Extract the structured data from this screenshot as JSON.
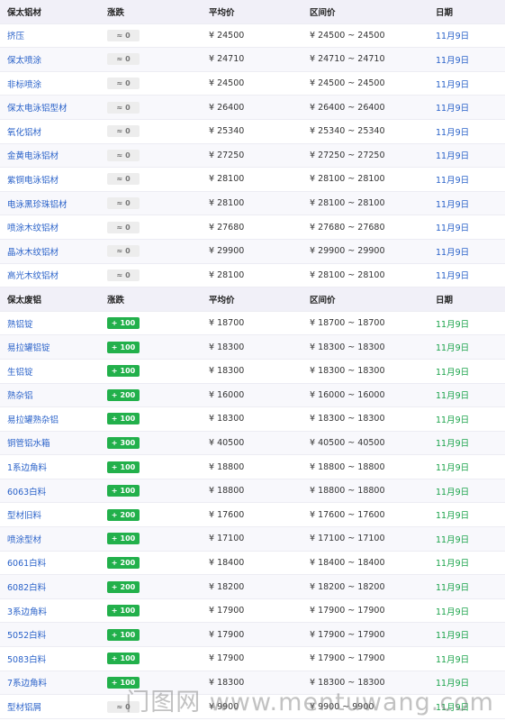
{
  "sections": [
    {
      "header": {
        "name": "保太铝材",
        "change": "涨跌",
        "avg": "平均价",
        "range": "区间价",
        "date": "日期"
      },
      "date_style": "blue",
      "rows": [
        {
          "name": "挤压",
          "change": "0",
          "dir": "flat",
          "avg": "¥ 24500",
          "range": "¥ 24500 ~ 24500",
          "date": "11月9日"
        },
        {
          "name": "保太喷涂",
          "change": "0",
          "dir": "flat",
          "avg": "¥ 24710",
          "range": "¥ 24710 ~ 24710",
          "date": "11月9日"
        },
        {
          "name": "非标喷涂",
          "change": "0",
          "dir": "flat",
          "avg": "¥ 24500",
          "range": "¥ 24500 ~ 24500",
          "date": "11月9日"
        },
        {
          "name": "保太电泳铝型材",
          "change": "0",
          "dir": "flat",
          "avg": "¥ 26400",
          "range": "¥ 26400 ~ 26400",
          "date": "11月9日"
        },
        {
          "name": "氧化铝材",
          "change": "0",
          "dir": "flat",
          "avg": "¥ 25340",
          "range": "¥ 25340 ~ 25340",
          "date": "11月9日"
        },
        {
          "name": "金黄电泳铝材",
          "change": "0",
          "dir": "flat",
          "avg": "¥ 27250",
          "range": "¥ 27250 ~ 27250",
          "date": "11月9日"
        },
        {
          "name": "紫铜电泳铝材",
          "change": "0",
          "dir": "flat",
          "avg": "¥ 28100",
          "range": "¥ 28100 ~ 28100",
          "date": "11月9日"
        },
        {
          "name": "电泳黑珍珠铝材",
          "change": "0",
          "dir": "flat",
          "avg": "¥ 28100",
          "range": "¥ 28100 ~ 28100",
          "date": "11月9日"
        },
        {
          "name": "喷涂木纹铝材",
          "change": "0",
          "dir": "flat",
          "avg": "¥ 27680",
          "range": "¥ 27680 ~ 27680",
          "date": "11月9日"
        },
        {
          "name": "晶冰木纹铝材",
          "change": "0",
          "dir": "flat",
          "avg": "¥ 29900",
          "range": "¥ 29900 ~ 29900",
          "date": "11月9日"
        },
        {
          "name": "高光木纹铝材",
          "change": "0",
          "dir": "flat",
          "avg": "¥ 28100",
          "range": "¥ 28100 ~ 28100",
          "date": "11月9日"
        }
      ]
    },
    {
      "header": {
        "name": "保太废铝",
        "change": "涨跌",
        "avg": "平均价",
        "range": "区间价",
        "date": "日期"
      },
      "date_style": "green",
      "rows": [
        {
          "name": "熟铝锭",
          "change": "100",
          "dir": "up",
          "avg": "¥ 18700",
          "range": "¥ 18700 ~ 18700",
          "date": "11月9日"
        },
        {
          "name": "易拉罐铝锭",
          "change": "100",
          "dir": "up",
          "avg": "¥ 18300",
          "range": "¥ 18300 ~ 18300",
          "date": "11月9日"
        },
        {
          "name": "生铝锭",
          "change": "100",
          "dir": "up",
          "avg": "¥ 18300",
          "range": "¥ 18300 ~ 18300",
          "date": "11月9日"
        },
        {
          "name": "熟杂铝",
          "change": "200",
          "dir": "up",
          "avg": "¥ 16000",
          "range": "¥ 16000 ~ 16000",
          "date": "11月9日"
        },
        {
          "name": "易拉罐熟杂铝",
          "change": "100",
          "dir": "up",
          "avg": "¥ 18300",
          "range": "¥ 18300 ~ 18300",
          "date": "11月9日"
        },
        {
          "name": "铜管铝水箱",
          "change": "300",
          "dir": "up",
          "avg": "¥ 40500",
          "range": "¥ 40500 ~ 40500",
          "date": "11月9日"
        },
        {
          "name": "1系边角料",
          "change": "100",
          "dir": "up",
          "avg": "¥ 18800",
          "range": "¥ 18800 ~ 18800",
          "date": "11月9日"
        },
        {
          "name": "6063白料",
          "change": "100",
          "dir": "up",
          "avg": "¥ 18800",
          "range": "¥ 18800 ~ 18800",
          "date": "11月9日"
        },
        {
          "name": "型材旧料",
          "change": "200",
          "dir": "up",
          "avg": "¥ 17600",
          "range": "¥ 17600 ~ 17600",
          "date": "11月9日"
        },
        {
          "name": "喷涂型材",
          "change": "100",
          "dir": "up",
          "avg": "¥ 17100",
          "range": "¥ 17100 ~ 17100",
          "date": "11月9日"
        },
        {
          "name": "6061白料",
          "change": "200",
          "dir": "up",
          "avg": "¥ 18400",
          "range": "¥ 18400 ~ 18400",
          "date": "11月9日"
        },
        {
          "name": "6082白料",
          "change": "200",
          "dir": "up",
          "avg": "¥ 18200",
          "range": "¥ 18200 ~ 18200",
          "date": "11月9日"
        },
        {
          "name": "3系边角料",
          "change": "100",
          "dir": "up",
          "avg": "¥ 17900",
          "range": "¥ 17900 ~ 17900",
          "date": "11月9日"
        },
        {
          "name": "5052白料",
          "change": "100",
          "dir": "up",
          "avg": "¥ 17900",
          "range": "¥ 17900 ~ 17900",
          "date": "11月9日"
        },
        {
          "name": "5083白料",
          "change": "100",
          "dir": "up",
          "avg": "¥ 17900",
          "range": "¥ 17900 ~ 17900",
          "date": "11月9日"
        },
        {
          "name": "7系边角料",
          "change": "100",
          "dir": "up",
          "avg": "¥ 18300",
          "range": "¥ 18300 ~ 18300",
          "date": "11月9日"
        },
        {
          "name": "型材铝屑",
          "change": "0",
          "dir": "flat",
          "avg": "¥ 9900",
          "range": "¥ 9900 ~ 9900",
          "date": "11月9日"
        }
      ]
    }
  ],
  "icons": {
    "flat": "wave-icon",
    "up": "plus-icon"
  },
  "colors": {
    "link": "#2a62c9",
    "up": "#22b04b",
    "date_green": "#1aa34a",
    "header_bg": "#f1f0f8"
  },
  "watermark": "门图网 www.mentuwang.com"
}
